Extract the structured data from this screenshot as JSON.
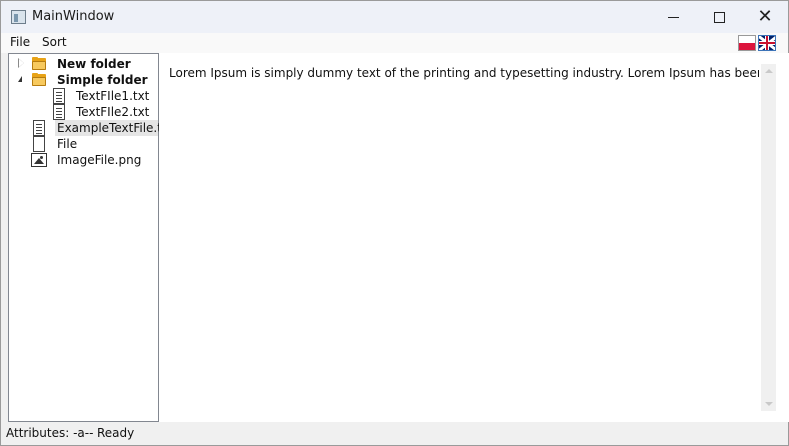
{
  "window": {
    "title": "MainWindow",
    "controls": {
      "minimize_icon": "minimize-icon",
      "maximize_icon": "maximize-icon",
      "close_icon": "close-icon"
    }
  },
  "menu": {
    "items": [
      {
        "label": "File"
      },
      {
        "label": "Sort"
      }
    ],
    "language_flags": [
      {
        "icon": "poland-flag-icon"
      },
      {
        "icon": "uk-flag-icon"
      }
    ]
  },
  "tree": {
    "items": [
      {
        "label": "New folder",
        "icon": "folder-icon",
        "expander": "collapsed"
      },
      {
        "label": "Simple folder",
        "icon": "folder-icon",
        "expander": "expanded"
      },
      {
        "label": "TextFIle1.txt",
        "icon": "text-file-icon"
      },
      {
        "label": "TextFIle2.txt",
        "icon": "text-file-icon"
      },
      {
        "label": "ExampleTextFile.txt",
        "icon": "text-file-icon",
        "selected": true
      },
      {
        "label": "File",
        "icon": "blank-file-icon"
      },
      {
        "label": "ImageFile.png",
        "icon": "image-file-icon"
      }
    ]
  },
  "content": {
    "text": "Lorem Ipsum is simply dummy text of the printing and typesetting industry. Lorem Ipsum has been the industry'"
  },
  "status": {
    "attributes": "Attributes: -a--",
    "state": "Ready"
  }
}
